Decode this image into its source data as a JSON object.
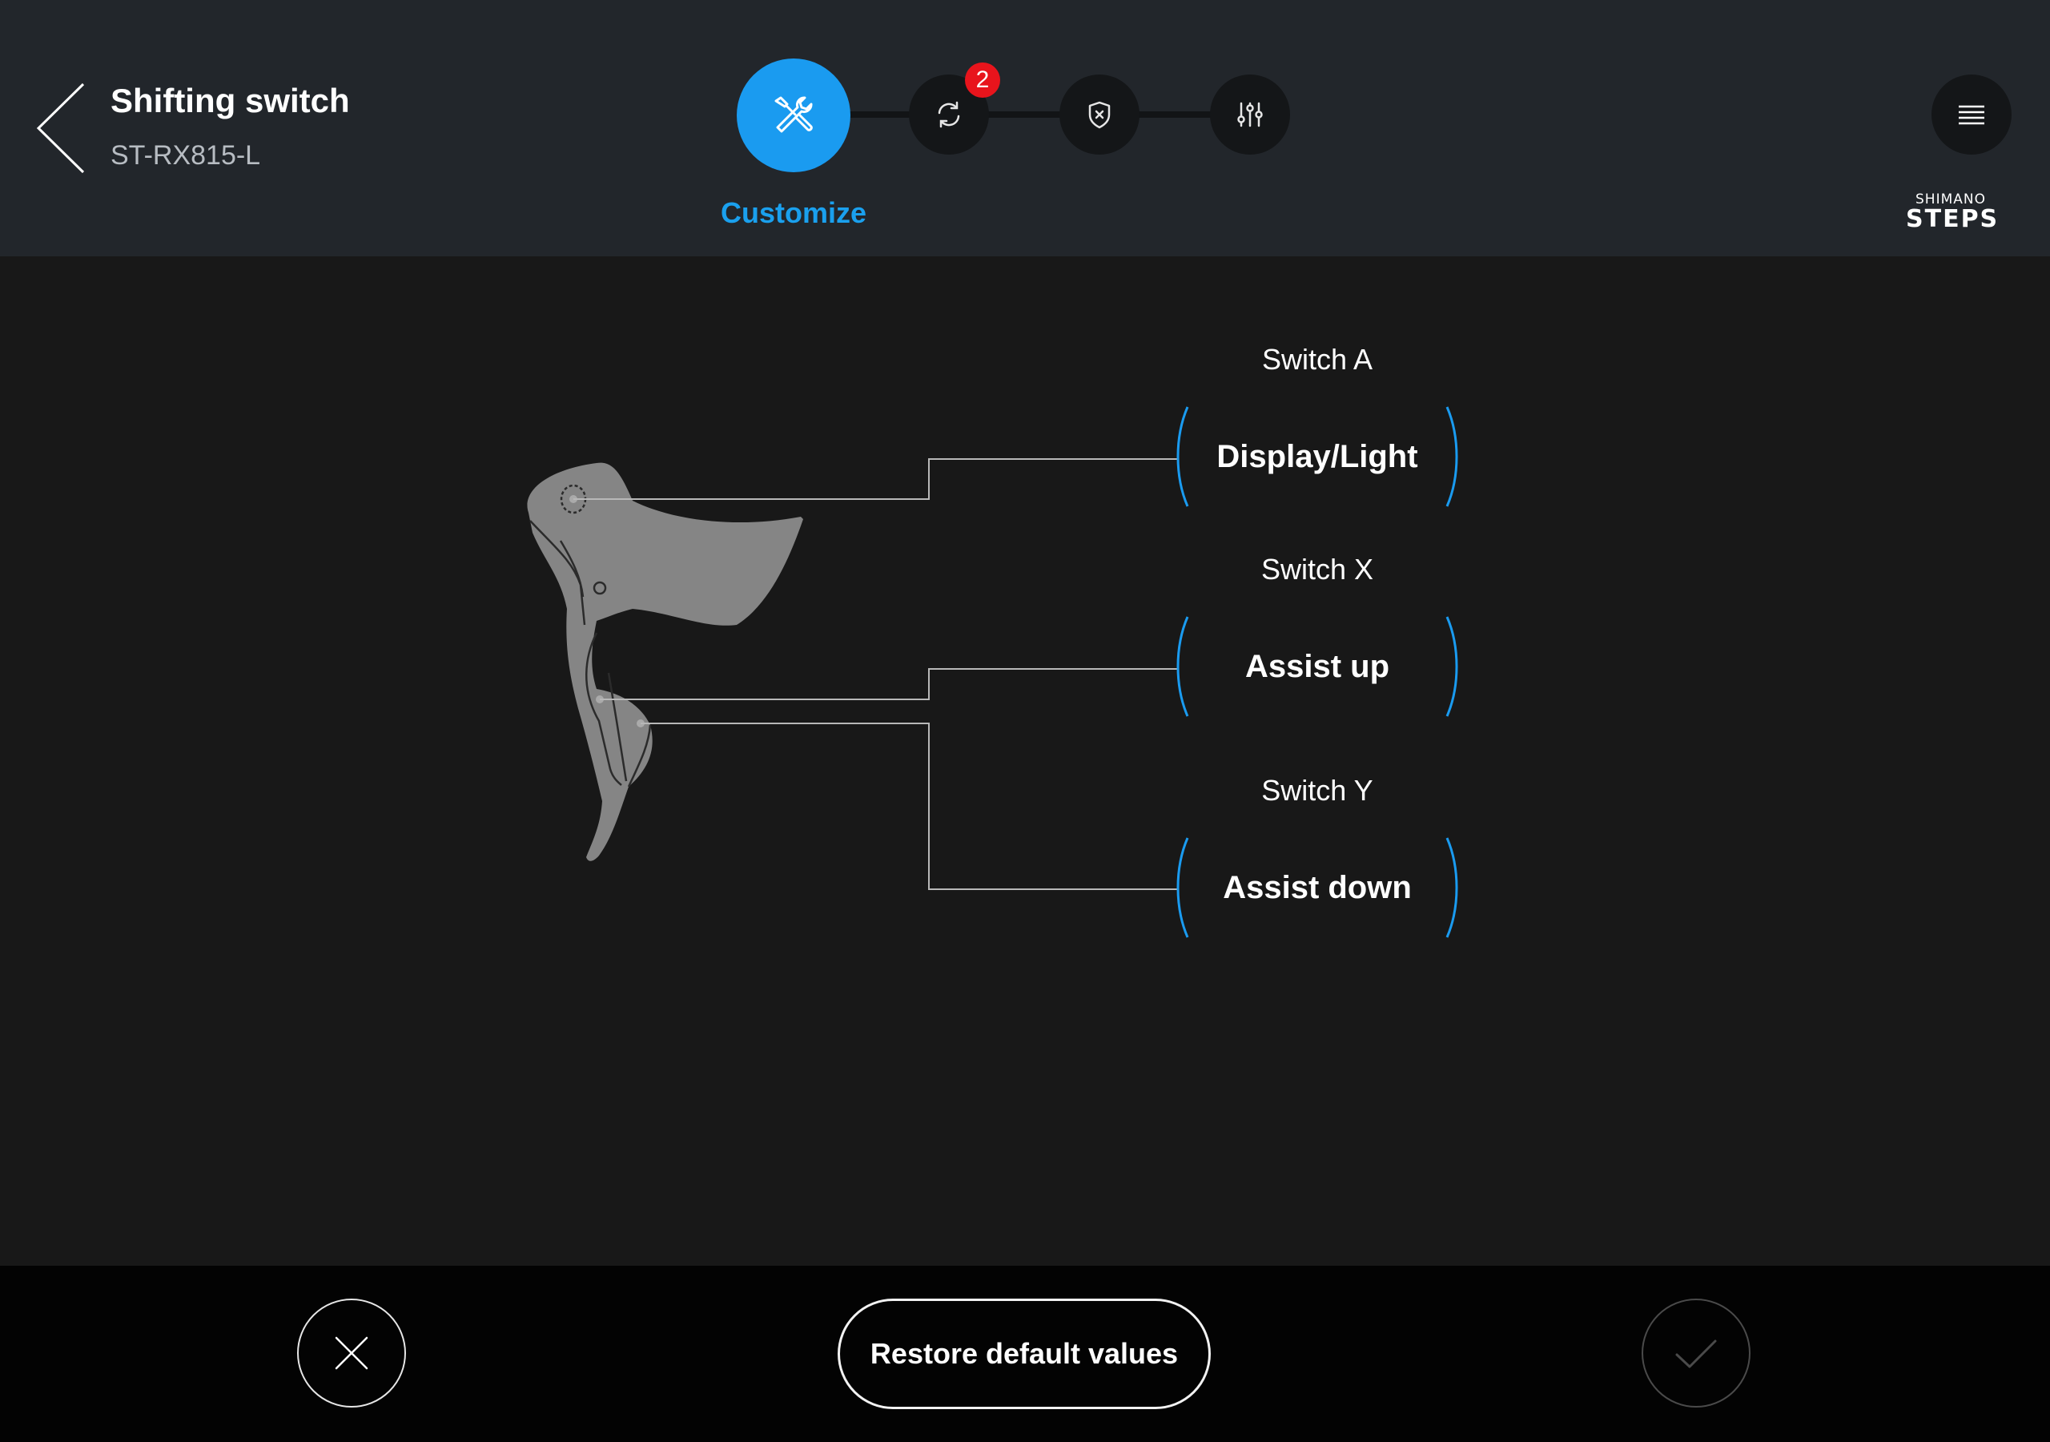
{
  "header": {
    "title": "Shifting switch",
    "model": "ST-RX815-L",
    "steps": [
      {
        "icon": "tools-icon",
        "label": "Customize",
        "active": true
      },
      {
        "icon": "sync-icon",
        "badge": "2",
        "active": false
      },
      {
        "icon": "shield-icon",
        "active": false
      },
      {
        "icon": "sliders-icon",
        "active": false
      }
    ],
    "active_step_label": "Customize",
    "update_badge": "2",
    "logo_top": "SHIMANO",
    "logo_bottom": "STEPS"
  },
  "switches": [
    {
      "label": "Switch A",
      "value": "Display/Light"
    },
    {
      "label": "Switch X",
      "value": "Assist up"
    },
    {
      "label": "Switch Y",
      "value": "Assist down"
    }
  ],
  "footer": {
    "restore_label": "Restore default values"
  },
  "colors": {
    "accent": "#1a9bf0",
    "badge": "#e8141c",
    "header_bg": "#22262b",
    "body_bg": "#181818",
    "footer_bg": "#030303"
  }
}
